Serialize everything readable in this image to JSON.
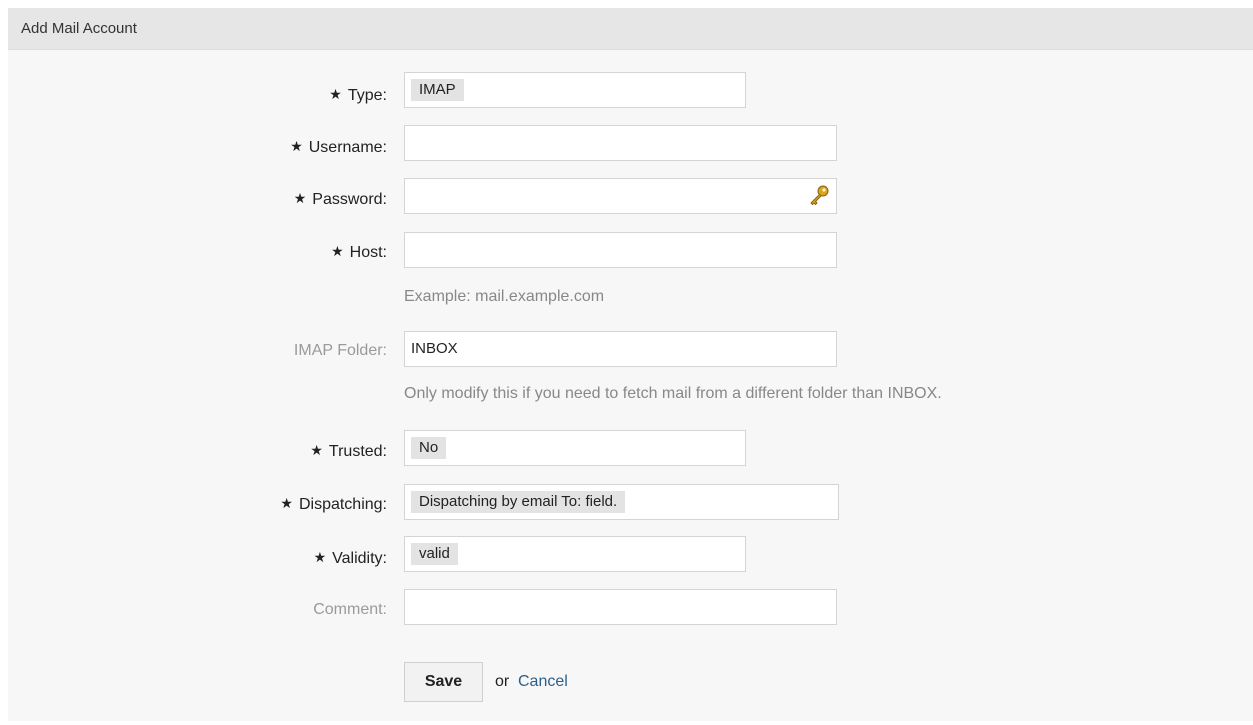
{
  "header": {
    "title": "Add Mail Account"
  },
  "form": {
    "type": {
      "label": "Type:",
      "value": "IMAP"
    },
    "username": {
      "label": "Username:",
      "value": ""
    },
    "password": {
      "label": "Password:",
      "value": ""
    },
    "host": {
      "label": "Host:",
      "value": "",
      "hint": "Example: mail.example.com"
    },
    "imap_folder": {
      "label": "IMAP Folder:",
      "value": "INBOX",
      "hint": "Only modify this if you need to fetch mail from a different folder than INBOX."
    },
    "trusted": {
      "label": "Trusted:",
      "value": "No"
    },
    "dispatching": {
      "label": "Dispatching:",
      "value": "Dispatching by email To: field."
    },
    "validity": {
      "label": "Validity:",
      "value": "valid"
    },
    "comment": {
      "label": "Comment:",
      "value": ""
    },
    "required_marker": "★"
  },
  "actions": {
    "save_label": "Save",
    "or_text": "or",
    "cancel_label": "Cancel"
  },
  "icons": {
    "password_toggle": "key-icon"
  },
  "colors": {
    "link": "#2d5f8a",
    "header_bg": "#e6e6e6",
    "panel_bg": "#f7f7f7"
  }
}
